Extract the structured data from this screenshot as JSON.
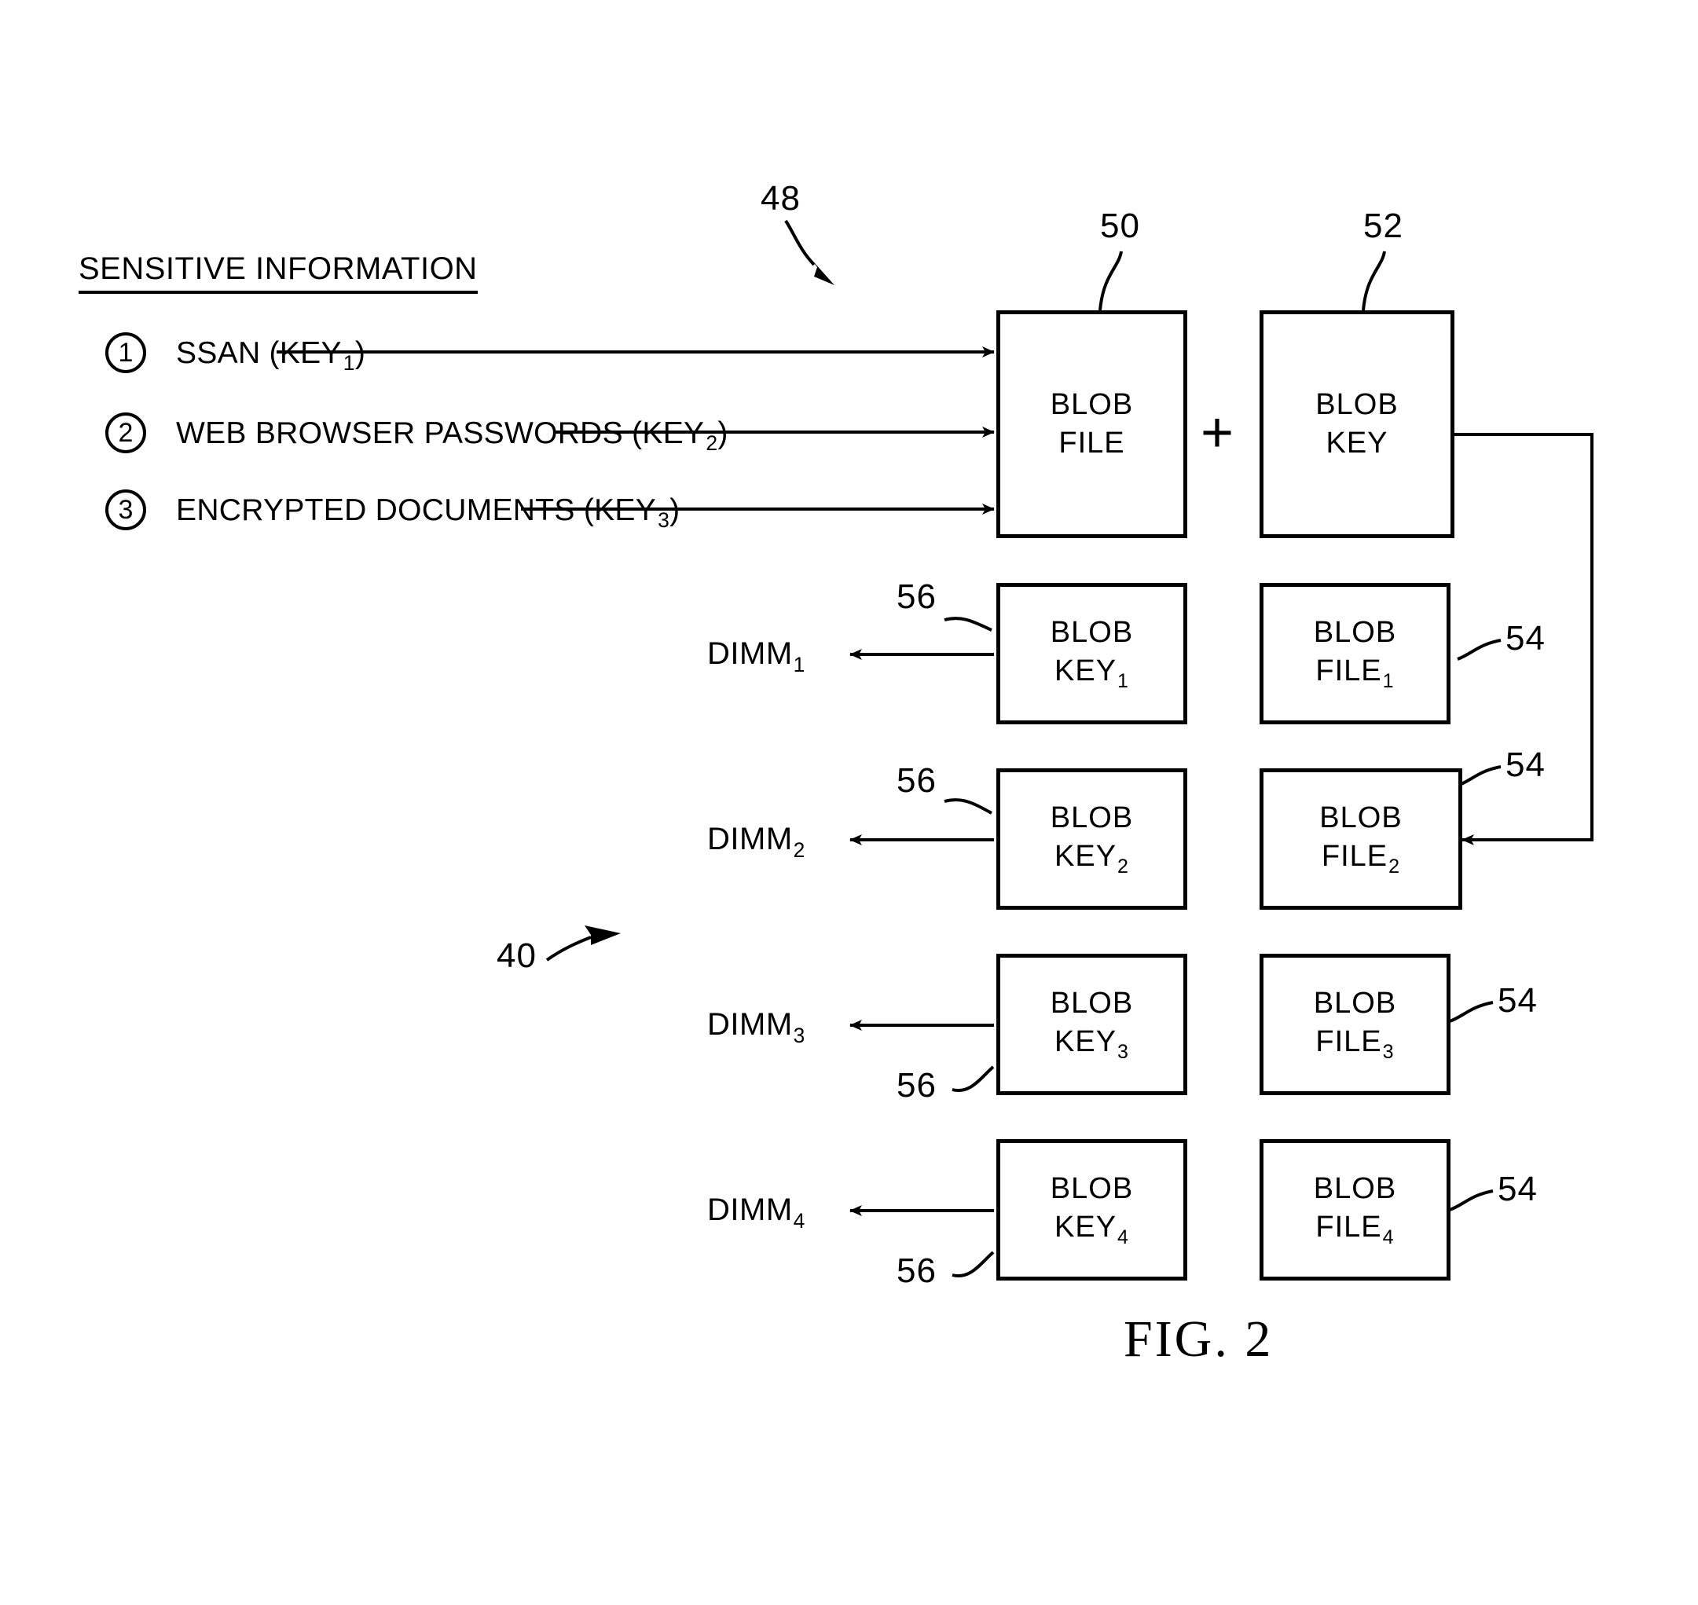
{
  "figure": {
    "caption": "FIG. 2",
    "system_ref": "40",
    "flow_ref": "48"
  },
  "sensitive_information": {
    "heading": "SENSITIVE INFORMATION",
    "items": [
      {
        "number": "1",
        "label": "SSAN (KEY",
        "sub": "1",
        "label_tail": ")"
      },
      {
        "number": "2",
        "label": "WEB BROWSER PASSWORDS (KEY",
        "sub": "2",
        "label_tail": ")"
      },
      {
        "number": "3",
        "label": "ENCRYPTED DOCUMENTS (KEY",
        "sub": "3",
        "label_tail": ")"
      }
    ]
  },
  "combiner": {
    "operator": "+",
    "blob_file": {
      "line1": "BLOB",
      "line2": "FILE",
      "ref": "50"
    },
    "blob_key": {
      "line1": "BLOB",
      "line2": "KEY",
      "ref": "52"
    }
  },
  "rows": [
    {
      "dimm": "DIMM",
      "dimm_sub": "1",
      "key_line1": "BLOB",
      "key_line2": "KEY",
      "key_sub": "1",
      "key_ref": "56",
      "file_line1": "BLOB",
      "file_line2": "FILE",
      "file_sub": "1",
      "file_ref": "54"
    },
    {
      "dimm": "DIMM",
      "dimm_sub": "2",
      "key_line1": "BLOB",
      "key_line2": "KEY",
      "key_sub": "2",
      "key_ref": "56",
      "file_line1": "BLOB",
      "file_line2": "FILE",
      "file_sub": "2",
      "file_ref": "54"
    },
    {
      "dimm": "DIMM",
      "dimm_sub": "3",
      "key_line1": "BLOB",
      "key_line2": "KEY",
      "key_sub": "3",
      "key_ref": "56",
      "file_line1": "BLOB",
      "file_line2": "FILE",
      "file_sub": "3",
      "file_ref": "54"
    },
    {
      "dimm": "DIMM",
      "dimm_sub": "4",
      "key_line1": "BLOB",
      "key_line2": "KEY",
      "key_sub": "4",
      "key_ref": "56",
      "file_line1": "BLOB",
      "file_line2": "FILE",
      "file_sub": "4",
      "file_ref": "54"
    }
  ],
  "colors": {
    "ink": "#000000",
    "paper": "#ffffff"
  }
}
